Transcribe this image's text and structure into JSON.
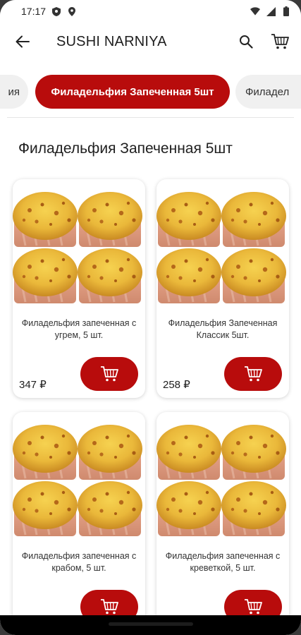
{
  "status_bar": {
    "time": "17:17",
    "icons_left": [
      "shield-icon",
      "location-icon"
    ],
    "icons_right": [
      "wifi-icon",
      "signal-icon",
      "battery-icon"
    ]
  },
  "app_bar": {
    "title": "SUSHI NARNIYA",
    "back_icon": "arrow-left-icon",
    "actions": [
      "search-icon",
      "cart-icon"
    ]
  },
  "categories": {
    "prev_label": "ия",
    "active_label": "Филадельфия Запеченная 5шт",
    "next_label": "Филадел"
  },
  "section": {
    "title": "Филадельфия Запеченная 5шт"
  },
  "products": [
    {
      "name": "Филадельфия запеченная с угрем, 5 шт.",
      "price": "347 ₽"
    },
    {
      "name": "Филадельфия Запеченная Классик 5шт.",
      "price": "258 ₽"
    },
    {
      "name": "Филадельфия запеченная с крабом, 5 шт.",
      "price": ""
    },
    {
      "name": "Филадельфия запеченная с креветкой, 5 шт.",
      "price": ""
    }
  ],
  "colors": {
    "accent": "#b80c0c",
    "background": "#ffffff",
    "chip_inactive": "#f0f0f0",
    "text_primary": "#202020"
  }
}
